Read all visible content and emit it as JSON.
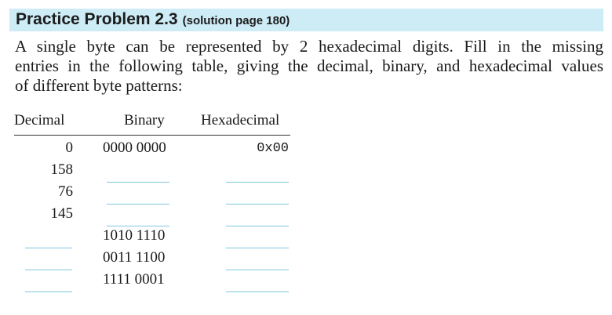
{
  "header": {
    "title": "Practice Problem 2.3",
    "subtitle": "(solution page 180)"
  },
  "intro_lines": [
    "A single byte can be represented by 2 hexadecimal digits. Fill in the missing",
    "entries in the following table, giving the decimal, binary, and hexadecimal values",
    "of different byte patterns:"
  ],
  "table": {
    "headers": {
      "decimal": "Decimal",
      "binary": "Binary",
      "hex": "Hexadecimal"
    },
    "rows": [
      {
        "decimal": "0",
        "binary": "0000 0000",
        "hex": "0x00"
      },
      {
        "decimal": "158",
        "binary": "",
        "hex": ""
      },
      {
        "decimal": "76",
        "binary": "",
        "hex": ""
      },
      {
        "decimal": "145",
        "binary": "",
        "hex": ""
      },
      {
        "decimal": "",
        "binary": "1010 1110",
        "hex": ""
      },
      {
        "decimal": "",
        "binary": "0011 1100",
        "hex": ""
      },
      {
        "decimal": "",
        "binary": "1111 0001",
        "hex": ""
      }
    ]
  }
}
